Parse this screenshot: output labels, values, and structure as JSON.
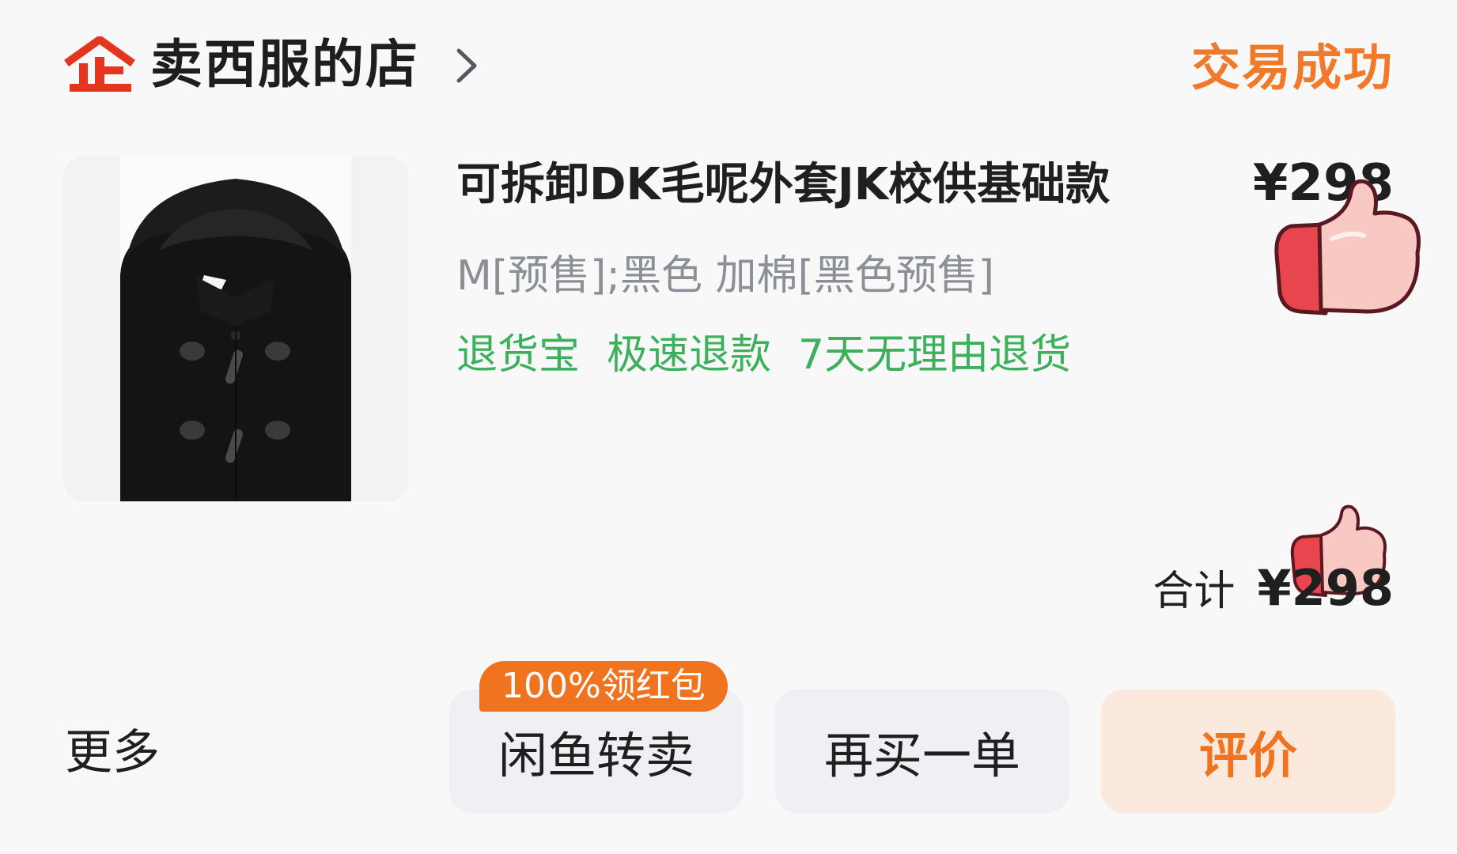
{
  "header": {
    "shop_logo_icon": "qi-shop-icon",
    "shop_name": "卖西服的店",
    "chevron_icon": "chevron-right-icon",
    "status": "交易成功"
  },
  "product": {
    "image_icon": "duffle-coat-thumbnail",
    "title": "可拆卸DK毛呢外套JK校供基础款",
    "price": "¥298",
    "spec": "M[预售];黑色 加棉[黑色预售]",
    "service_tags": [
      "退货宝",
      "极速退款",
      "7天无理由退货"
    ]
  },
  "total": {
    "label": "合计",
    "value": "¥298"
  },
  "footer": {
    "more_label": "更多",
    "promo_badge": "100%领红包",
    "resell_label": "闲鱼转卖",
    "rebuy_label": "再买一单",
    "review_label": "评价"
  },
  "colors": {
    "status": "#f07a2a",
    "service_tags": "#3cb05a",
    "review_button_bg": "#fbe9de",
    "review_button_text": "#f0731f",
    "promo_badge_bg": "#f0731f",
    "shop_logo": "#e4361f"
  },
  "stickers": [
    "thumbs-up-icon",
    "thumbs-up-icon"
  ]
}
